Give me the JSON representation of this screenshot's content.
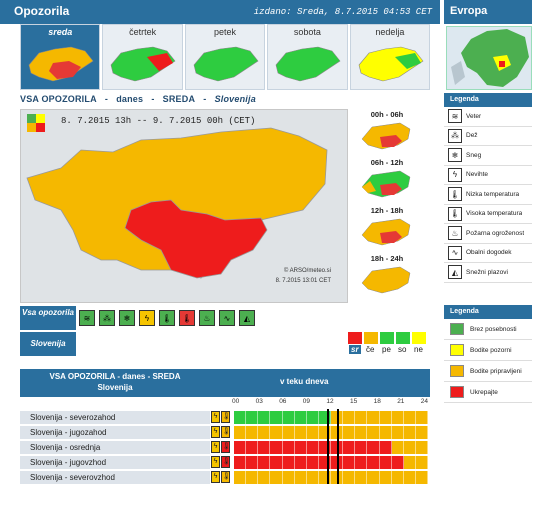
{
  "header": {
    "title": "Opozorila",
    "issued": "izdano: Sreda, 8.7.2015 04:53 CET",
    "europe": "Evropa"
  },
  "days": [
    {
      "label": "sreda",
      "selected": true
    },
    {
      "label": "četrtek",
      "selected": false
    },
    {
      "label": "petek",
      "selected": false
    },
    {
      "label": "sobota",
      "selected": false
    },
    {
      "label": "nedelja",
      "selected": false
    }
  ],
  "subtitle": {
    "a": "VSA OPOZORILA",
    "d1": "-",
    "b": "danes",
    "d2": "-",
    "c": "SREDA",
    "d3": "-",
    "d": "Slovenija"
  },
  "map": {
    "range": "8. 7.2015 13h  --  9. 7.2015 00h    (CET)",
    "copyright": "© ARSO/meteo.si",
    "stamp": "8. 7.2015  13:01 CET"
  },
  "periods": [
    "00h - 06h",
    "06h - 12h",
    "12h - 18h",
    "18h - 24h"
  ],
  "legend": {
    "title": "Legenda",
    "items": [
      "Veter",
      "Dež",
      "Sneg",
      "Nevihte",
      "Nizka temperatura",
      "Visoka temperatura",
      "Požarna ogroženost",
      "Obalni dogodek",
      "Snežni plazovi"
    ]
  },
  "legend2": {
    "title": "Legenda",
    "items": [
      {
        "label": "Brez posebnosti",
        "color": "#4caf50"
      },
      {
        "label": "Bodite pozorni",
        "color": "#ffff00"
      },
      {
        "label": "Bodite pripravljeni",
        "color": "#f5b800"
      },
      {
        "label": "Ukrepajte",
        "color": "#ee1c1c"
      }
    ]
  },
  "row_labels": {
    "vsa": "Vsa opozorila",
    "slo": "Slovenija"
  },
  "scale": {
    "labels": [
      "sr",
      "če",
      "pe",
      "so",
      "ne"
    ]
  },
  "table": {
    "head_a1": "VSA OPOZORILA - danes - SREDA",
    "head_a2": "Slovenija",
    "head_b": "v teku dneva",
    "ticks": [
      "00",
      "03",
      "06",
      "09",
      "12",
      "15",
      "18",
      "21",
      "24"
    ],
    "rows": [
      {
        "name": "Slovenija - severozahod",
        "levels": [
          0,
          0,
          0,
          0,
          0,
          0,
          0,
          0,
          1,
          1,
          1,
          1,
          1,
          1,
          1,
          1
        ]
      },
      {
        "name": "Slovenija - jugozahod",
        "levels": [
          1,
          1,
          1,
          1,
          1,
          1,
          1,
          1,
          1,
          1,
          1,
          1,
          1,
          1,
          1,
          1
        ]
      },
      {
        "name": "Slovenija - osrednja",
        "levels": [
          2,
          2,
          2,
          2,
          2,
          2,
          2,
          2,
          2,
          2,
          2,
          2,
          2,
          1,
          1,
          1
        ]
      },
      {
        "name": "Slovenija - jugovzhod",
        "levels": [
          2,
          2,
          2,
          2,
          2,
          2,
          2,
          2,
          2,
          2,
          2,
          2,
          2,
          2,
          1,
          1
        ]
      },
      {
        "name": "Slovenija - severovzhod",
        "levels": [
          1,
          1,
          1,
          1,
          1,
          1,
          1,
          1,
          1,
          1,
          1,
          1,
          1,
          1,
          1,
          1
        ]
      }
    ]
  }
}
